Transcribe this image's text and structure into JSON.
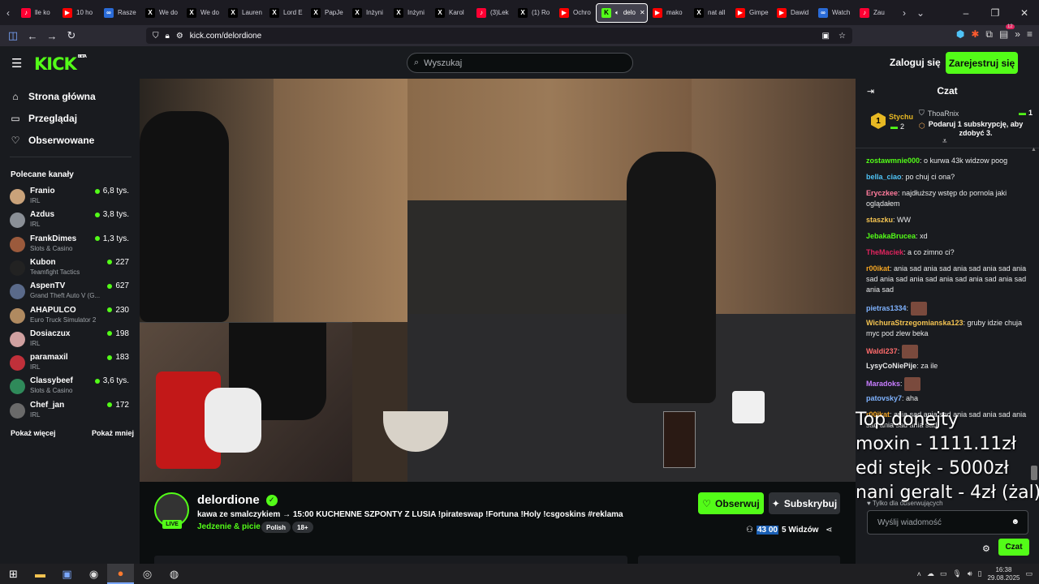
{
  "browser": {
    "tabs": [
      {
        "label": "lle ko",
        "color": "#ff0033",
        "glyph": "♪"
      },
      {
        "label": "10 ho",
        "color": "#ff0000",
        "glyph": "▶"
      },
      {
        "label": "Raszе",
        "color": "#2a6bd8",
        "glyph": "∞"
      },
      {
        "label": "We do",
        "color": "#000000",
        "glyph": "X"
      },
      {
        "label": "We do",
        "color": "#000000",
        "glyph": "X"
      },
      {
        "label": "Lauren",
        "color": "#000000",
        "glyph": "X"
      },
      {
        "label": "Lord E",
        "color": "#000000",
        "glyph": "X"
      },
      {
        "label": "PapJe",
        "color": "#000000",
        "glyph": "X"
      },
      {
        "label": "Inżyni",
        "color": "#000000",
        "glyph": "X"
      },
      {
        "label": "Inżyni",
        "color": "#000000",
        "glyph": "X"
      },
      {
        "label": "Karol",
        "color": "#000000",
        "glyph": "X"
      },
      {
        "label": "(3)Lek",
        "color": "#ff0033",
        "glyph": "♪"
      },
      {
        "label": "(1) Ro",
        "color": "#000000",
        "glyph": "X"
      },
      {
        "label": "Ochro",
        "color": "#ff0000",
        "glyph": "▶"
      },
      {
        "label": "delo",
        "color": "#53fc18",
        "glyph": "K",
        "active": true
      },
      {
        "label": "mako",
        "color": "#ff0000",
        "glyph": "▶"
      },
      {
        "label": "nat all",
        "color": "#000000",
        "glyph": "X"
      },
      {
        "label": "Gimpe",
        "color": "#ff0000",
        "glyph": "▶"
      },
      {
        "label": "Dawid",
        "color": "#ff0000",
        "glyph": "▶"
      },
      {
        "label": "Watch",
        "color": "#2a6bd8",
        "glyph": "∞"
      },
      {
        "label": "Zau",
        "color": "#ff0033",
        "glyph": "♪"
      }
    ],
    "url": "kick.com/delordione",
    "badge_count": "12"
  },
  "header": {
    "logo": "KICK",
    "logo_sup": "BETA",
    "search_placeholder": "Wyszukaj",
    "login": "Zaloguj się",
    "register": "Zarejestruj się"
  },
  "sidebar": {
    "nav": [
      "Strona główna",
      "Przeglądaj",
      "Obserwowane"
    ],
    "recommended_title": "Polecane kanały",
    "channels": [
      {
        "name": "Franio",
        "category": "IRL",
        "viewers": "6,8 tys.",
        "color": "#c9a27a"
      },
      {
        "name": "Azdus",
        "category": "IRL",
        "viewers": "3,8 tys.",
        "color": "#8a8f96"
      },
      {
        "name": "FrankDimes",
        "category": "Slots & Casino",
        "viewers": "1,3 tys.",
        "color": "#9b5a3c"
      },
      {
        "name": "Kubon",
        "category": "Teamfight Tactics",
        "viewers": "227",
        "color": "#222222"
      },
      {
        "name": "AspenTV",
        "category": "Grand Theft Auto V (G...",
        "viewers": "627",
        "color": "#5a6a8a"
      },
      {
        "name": "AHAPULCO",
        "category": "Euro Truck Simulator 2",
        "viewers": "230",
        "color": "#b08a60"
      },
      {
        "name": "Dosiaczux",
        "category": "IRL",
        "viewers": "198",
        "color": "#d0a0a0"
      },
      {
        "name": "paramaxil",
        "category": "IRL",
        "viewers": "183",
        "color": "#c0303a"
      },
      {
        "name": "Classybeef",
        "category": "Slots & Casino",
        "viewers": "3,6 tys.",
        "color": "#2f8a5a"
      },
      {
        "name": "Chef_jan",
        "category": "IRL",
        "viewers": "172",
        "color": "#6a6a6a"
      }
    ],
    "show_more": "Pokaż więcej",
    "show_less": "Pokaż mniej"
  },
  "stream": {
    "channel": "delordione",
    "live": "LIVE",
    "title": "kawa ze smalczykiem → 15:00 KUCHENNE SZPONTY Z LUSIA !pirateswap !Fortuna !Holy !csgoskins  #reklama",
    "category": "Jedzenie & picie",
    "tags": [
      "Polish",
      "18+"
    ],
    "follow": "Obserwuj",
    "subscribe": "Subskrybuj",
    "viewers_num": "43 00",
    "viewers_rest": "5 Widzów"
  },
  "chat": {
    "title": "Czat",
    "leader_rank": "1",
    "leader_user": "Stychu",
    "leader_count": "2",
    "gift_user": "ThoaRnix",
    "gift_count": "1",
    "gift_cta": "Podaruj 1 subskrypcję, aby zdobyć 3.",
    "messages": [
      {
        "user": "zostawmnie000",
        "color": "#53fc18",
        "text": "o kurwa 43k widzow poog"
      },
      {
        "user": "bella_ciao",
        "color": "#4fc3f7",
        "text": "po chuj ci ona?"
      },
      {
        "user": "Eryczkee",
        "color": "#ff7b9c",
        "text": "najdłuższy wstęp do pornola jaki oglądałem"
      },
      {
        "user": "staszku",
        "color": "#f5c451",
        "text": "WW"
      },
      {
        "user": "JebakaBrucea",
        "color": "#53fc18",
        "text": "xd"
      },
      {
        "user": "TheMaciek",
        "color": "#e0245e",
        "text": "a co zimno ci?"
      },
      {
        "user": "r00ikat",
        "color": "#f5a623",
        "text": "ania sad ania sad ania sad ania sad ania sad ania sad ania sad ania sad ania sad ania sad ania sad"
      },
      {
        "user": "pietras1334",
        "color": "#7fb3ff",
        "text": "",
        "emote": true
      },
      {
        "user": "WichuraStrzegomianska123",
        "color": "#f5c451",
        "text": "gruby idzie chuja myc pod zlew beka"
      },
      {
        "user": "Waldi237",
        "color": "#ff6b6b",
        "text": "",
        "emote": true
      },
      {
        "user": "LysyCoNiePije",
        "color": "#e8e9ea",
        "text": "za ile"
      },
      {
        "user": "Maradoks",
        "color": "#c77dff",
        "text": "",
        "emote": true
      },
      {
        "user": "patovsky7",
        "color": "#7fb3ff",
        "text": "aha"
      },
      {
        "user": "r00ikat",
        "color": "#f5a623",
        "text": "ania sad ania sad ania sad ania sad ania sad ania sad ania sad"
      }
    ],
    "overlay_lines": [
      "Top donejty",
      "moxin - 1111.11zł",
      "edi stejk - 5000zł",
      "nani geralt - 4zł (żal)"
    ],
    "followers_only": "Tylko dla obserwujących",
    "input_placeholder": "Wyślij wiadomość",
    "send": "Czat"
  },
  "taskbar": {
    "time": "16:38",
    "date": "29.08.2025"
  }
}
